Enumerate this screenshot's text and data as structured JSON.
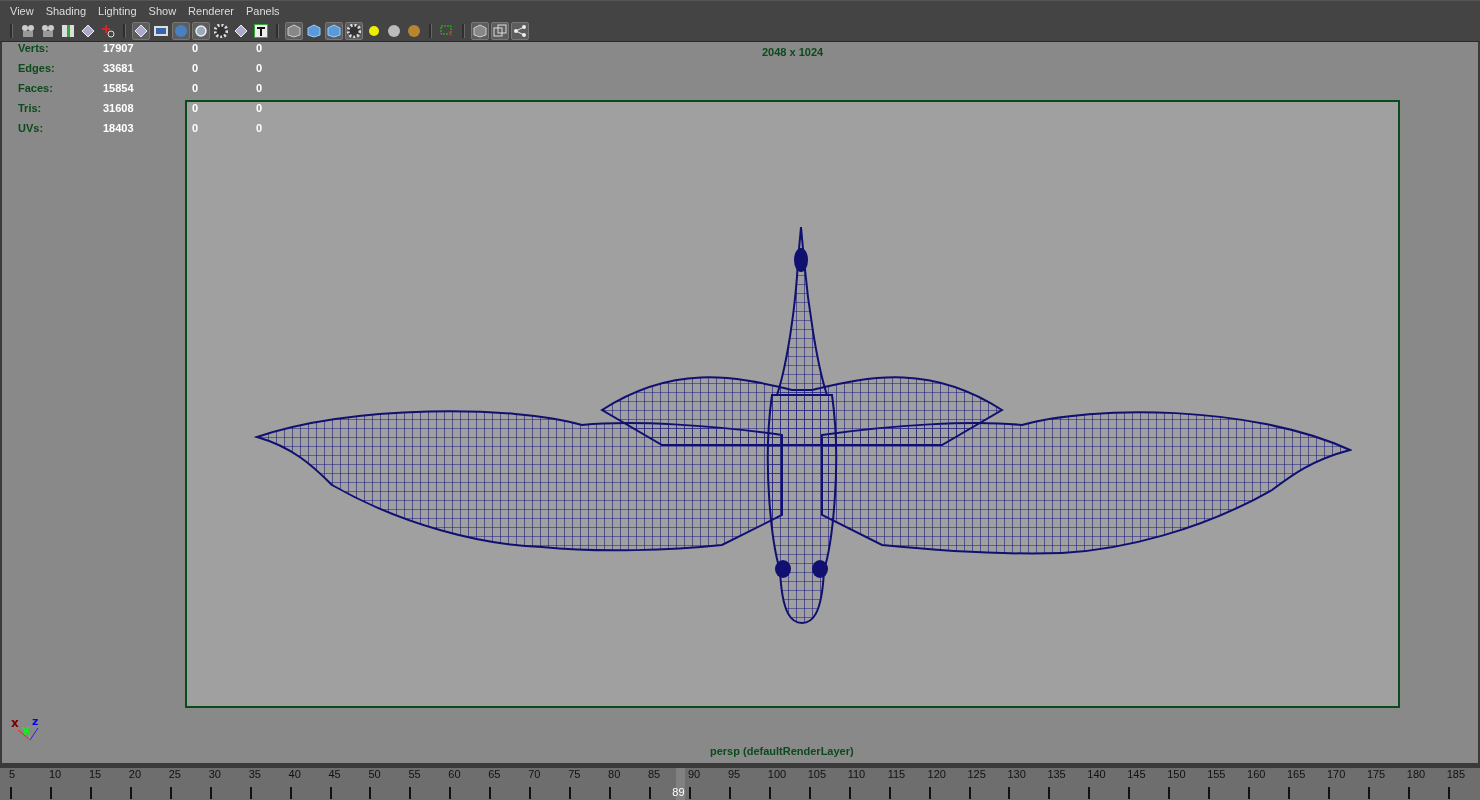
{
  "menu": [
    "View",
    "Shading",
    "Lighting",
    "Show",
    "Renderer",
    "Panels"
  ],
  "hud": {
    "rows": [
      {
        "label": "Verts:",
        "values": [
          "17907",
          "0",
          "0"
        ]
      },
      {
        "label": "Edges:",
        "values": [
          "33681",
          "0",
          "0"
        ]
      },
      {
        "label": "Faces:",
        "values": [
          "15854",
          "0",
          "0"
        ]
      },
      {
        "label": "Tris:",
        "values": [
          "31608",
          "0",
          "0"
        ]
      },
      {
        "label": "UVs:",
        "values": [
          "18403",
          "0",
          "0"
        ]
      }
    ],
    "resolution": "2048 x 1024",
    "camera": "persp (defaultRenderLayer)"
  },
  "axis": {
    "x": "x",
    "y": "y",
    "z": "z"
  },
  "timeline": {
    "ticks": [
      "5",
      "10",
      "15",
      "20",
      "25",
      "30",
      "35",
      "40",
      "45",
      "50",
      "55",
      "60",
      "65",
      "70",
      "75",
      "80",
      "85",
      "90",
      "95",
      "100",
      "105",
      "110",
      "115",
      "120",
      "125",
      "130",
      "135",
      "140",
      "145",
      "150",
      "155",
      "160",
      "165",
      "170",
      "175",
      "180",
      "185"
    ],
    "current_frame": "89",
    "level": 0.457
  }
}
